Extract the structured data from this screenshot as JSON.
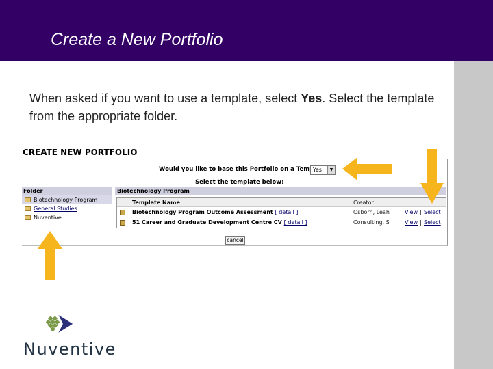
{
  "slide": {
    "title": "Create a New Portfolio",
    "instruction_part1": "When asked if you want to use a template, select ",
    "instruction_bold": "Yes",
    "instruction_part2": ".  Select the template from the appropriate folder."
  },
  "screenshot": {
    "heading": "CREATE NEW PORTFOLIO",
    "template_question": "Would you like to base this Portfolio on a Template?",
    "template_choice": "Yes",
    "select_prompt": "Select the template below:",
    "folder_header": "Folder",
    "folders": [
      {
        "label": "Biotechnology Program",
        "selected": true
      },
      {
        "label": "General Studies",
        "selected": false
      },
      {
        "label": "Nuventive",
        "selected": false
      }
    ],
    "template_pane_header": "Biotechnology Program",
    "columns": {
      "name": "Template Name",
      "creator": "Creator"
    },
    "templates": [
      {
        "name": "Biotechnology Program Outcome Assessment",
        "detail": "[ detail ]",
        "creator": "Osborn, Leah",
        "view": "View",
        "separator": "|",
        "select": "Select"
      },
      {
        "name": "51 Career and Graduate Development Centre CV",
        "detail": "[ detail ]",
        "creator": "Consulting, S",
        "view": "View",
        "separator": "|",
        "select": "Select"
      }
    ],
    "cancel_label": "cancel"
  },
  "logo": {
    "name": "Nuventive",
    "text": "Nuventive"
  },
  "colors": {
    "header_bg": "#330066",
    "arrow_fill": "#f7b51d",
    "sidebar_gray": "#c8c8c8"
  },
  "icons": [
    "folder-icon",
    "template-icon",
    "arrow-left-icon",
    "arrow-down-icon",
    "arrow-up-icon"
  ]
}
